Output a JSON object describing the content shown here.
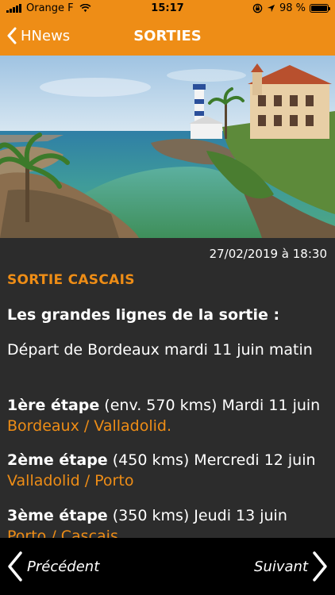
{
  "status_bar": {
    "carrier": "Orange F",
    "time": "15:17",
    "battery": "98 %",
    "battery_level": 0.98
  },
  "nav": {
    "back_label": "HNews",
    "title": "SORTIES"
  },
  "hero": {
    "description_icon": "coastal-landscape-photo"
  },
  "article": {
    "date": "27/02/2019 à 18:30",
    "title": "SORTIE CASCAIS",
    "subtitle": "Les grandes lignes de la sortie :",
    "intro": "Départ de Bordeaux mardi 11 juin matin",
    "stages": [
      {
        "label": "1ère étape",
        "details": " (env. 570 kms) Mardi 11 juin ",
        "route": "Bordeaux / Valladolid."
      },
      {
        "label": "2ème étape",
        "details": " (450 kms) Mercredi 12 juin ",
        "route": "Valladolid / Porto"
      },
      {
        "label": "3ème étape",
        "details": " (350 kms) Jeudi 13 juin ",
        "route": "Porto / Cascais"
      }
    ]
  },
  "bottom_bar": {
    "prev_label": "Précédent",
    "next_label": "Suivant"
  },
  "colors": {
    "accent": "#ee8d16",
    "background": "#2c2c2c",
    "bottom_bar": "#000000"
  }
}
